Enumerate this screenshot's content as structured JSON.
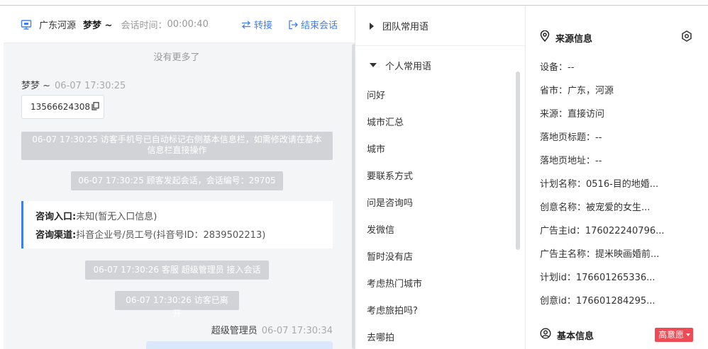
{
  "chat_header": {
    "region": "广东河源",
    "visitor_name": "梦梦 ~",
    "session_time_label": "会话时间：",
    "session_time": "00:00:40",
    "transfer_label": "转接",
    "end_label": "结束会话"
  },
  "chat": {
    "no_more": "没有更多了",
    "visitor_msg": {
      "sender": "梦梦 ~",
      "time": "06-07 17:30:25",
      "text": "13566624308"
    },
    "system_msgs": [
      "06-07 17:30:25 访客手机号已自动标记右侧基本信息栏，如需修改请在基本信息栏直接操作",
      "06-07 17:30:25 顾客发起会话，会话编号：29705",
      "06-07 17:30:26 客服 超级管理员 接入会话",
      "06-07 17:30:26 访客已离开"
    ],
    "consult": {
      "entry_label": "咨询入口:",
      "entry_value": "未知(暂无入口信息)",
      "channel_label": "咨询渠道:",
      "channel_value": "抖音企业号/员工号(抖音号ID：2839502213)"
    },
    "agent_msg": {
      "sender": "超级管理员",
      "time": "06-07 17:30:34"
    }
  },
  "phrases": {
    "team_group": "团队常用语",
    "personal_group": "个人常用语",
    "items": [
      "问好",
      "城市汇总",
      "城市",
      "要联系方式",
      "问是咨询吗",
      "发微信",
      "暂时没有店",
      "考虑热门城市",
      "考虑旅拍吗?",
      "去哪拍"
    ]
  },
  "source": {
    "title": "来源信息",
    "items": [
      "设备：--",
      "省市：广东，河源",
      "来源：直接访问",
      "落地页标题：--",
      "落地页地址：--",
      "计划名称：0516-目的地婚...",
      "创意名称：被宠爱的女生...",
      "广告主id：176022240796...",
      "广告主名称：提米映画婚前...",
      "计划id：176601265336...",
      "创意id：176601284295..."
    ],
    "basic_title": "基本信息",
    "intent_label": "高意愿"
  },
  "colors": {
    "accent": "#3d7ef0",
    "intent": "#ee4b55",
    "system_bg": "#d2d3d6"
  }
}
